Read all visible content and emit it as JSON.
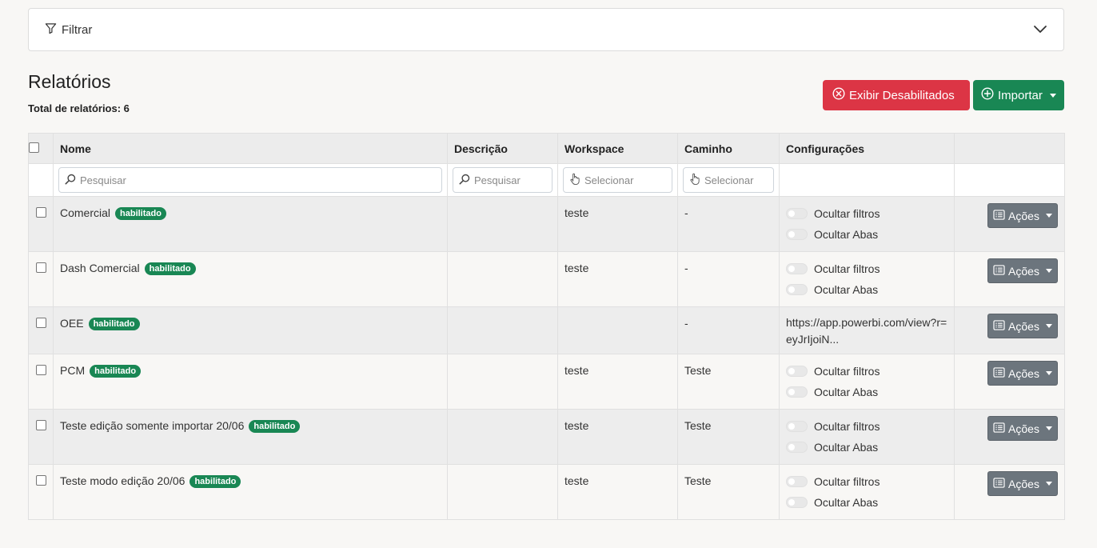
{
  "filter": {
    "label": "Filtrar"
  },
  "page": {
    "title": "Relatórios",
    "total_label": "Total de relatórios: 6"
  },
  "buttons": {
    "show_disabled": "Exibir Desabilitados",
    "import": "Importar"
  },
  "table": {
    "headers": [
      "Nome",
      "Descrição",
      "Workspace",
      "Caminho",
      "Configurações"
    ],
    "search": {
      "nome_placeholder": "Pesquisar",
      "descricao_placeholder": "Pesquisar",
      "workspace_placeholder": "Selecionar",
      "caminho_placeholder": "Selecionar"
    },
    "config_labels": {
      "hide_filters": "Ocultar filtros",
      "hide_tabs": "Ocultar Abas"
    },
    "actions_label": "Ações",
    "rows": [
      {
        "name": "Comercial",
        "badge": "habilitado",
        "description": "",
        "workspace": "teste",
        "path": "-"
      },
      {
        "name": "Dash Comercial",
        "badge": "habilitado",
        "description": "",
        "workspace": "teste",
        "path": "-"
      },
      {
        "name": "OEE",
        "badge": "habilitado",
        "description": "",
        "workspace": "",
        "path": "-",
        "config_url": "https://app.powerbi.com/view?r=eyJrIjoiN..."
      },
      {
        "name": "PCM",
        "badge": "habilitado",
        "description": "",
        "workspace": "teste",
        "path": "Teste"
      },
      {
        "name": "Teste edição somente importar 20/06",
        "badge": "habilitado",
        "description": "",
        "workspace": "teste",
        "path": "Teste"
      },
      {
        "name": "Teste modo edição 20/06",
        "badge": "habilitado",
        "description": "",
        "workspace": "teste",
        "path": "Teste"
      }
    ]
  },
  "colors": {
    "danger": "#dc3545",
    "success": "#198754",
    "secondary": "#6c757d"
  }
}
